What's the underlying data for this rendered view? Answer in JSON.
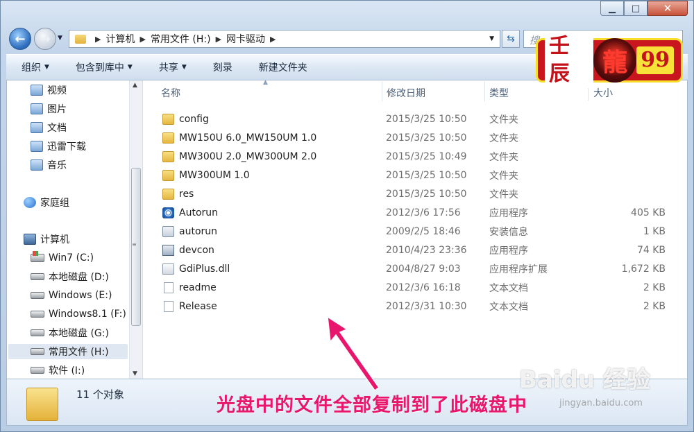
{
  "window": {
    "minimize_label": "▁",
    "maximize_label": "□",
    "close_label": "✕"
  },
  "address_bar": {
    "crumbs": [
      "计算机",
      "常用文件 (H:)",
      "网卡驱动"
    ]
  },
  "search": {
    "placeholder": "搜"
  },
  "toolbar": {
    "organize": "组织",
    "include_library": "包含到库中",
    "share": "共享",
    "burn": "刻录",
    "new_folder": "新建文件夹"
  },
  "sidebar": {
    "items": [
      {
        "label": "视频",
        "icon": "library-icon"
      },
      {
        "label": "图片",
        "icon": "library-icon"
      },
      {
        "label": "文档",
        "icon": "library-icon"
      },
      {
        "label": "迅雷下载",
        "icon": "library-icon"
      },
      {
        "label": "音乐",
        "icon": "library-icon"
      },
      {
        "label": "家庭组",
        "icon": "homegroup-icon"
      },
      {
        "label": "计算机",
        "icon": "computer-icon"
      },
      {
        "label": "Win7 (C:)",
        "icon": "system-drive-icon"
      },
      {
        "label": "本地磁盘 (D:)",
        "icon": "drive-icon"
      },
      {
        "label": "Windows (E:)",
        "icon": "drive-icon"
      },
      {
        "label": "Windows8.1 (F:)",
        "icon": "drive-icon"
      },
      {
        "label": "本地磁盘 (G:)",
        "icon": "drive-icon"
      },
      {
        "label": "常用文件 (H:)",
        "icon": "drive-icon",
        "selected": true
      },
      {
        "label": "软件 (I:)",
        "icon": "drive-icon"
      }
    ]
  },
  "columns": {
    "name": "名称",
    "date": "修改日期",
    "type": "类型",
    "size": "大小"
  },
  "files": [
    {
      "name": "config",
      "date": "2015/3/25 10:50",
      "type": "文件夹",
      "size": "",
      "icon": "folder-icon"
    },
    {
      "name": "MW150U 6.0_MW150UM 1.0",
      "date": "2015/3/25 10:50",
      "type": "文件夹",
      "size": "",
      "icon": "folder-icon"
    },
    {
      "name": "MW300U 2.0_MW300UM 2.0",
      "date": "2015/3/25 10:49",
      "type": "文件夹",
      "size": "",
      "icon": "folder-icon"
    },
    {
      "name": "MW300UM 1.0",
      "date": "2015/3/25 10:50",
      "type": "文件夹",
      "size": "",
      "icon": "folder-icon"
    },
    {
      "name": "res",
      "date": "2015/3/25 10:50",
      "type": "文件夹",
      "size": "",
      "icon": "folder-icon"
    },
    {
      "name": "Autorun",
      "date": "2012/3/6 17:56",
      "type": "应用程序",
      "size": "405 KB",
      "icon": "app-icon"
    },
    {
      "name": "autorun",
      "date": "2009/2/5 18:46",
      "type": "安装信息",
      "size": "1 KB",
      "icon": "setup-info-icon"
    },
    {
      "name": "devcon",
      "date": "2010/4/23 23:36",
      "type": "应用程序",
      "size": "74 KB",
      "icon": "exe-icon"
    },
    {
      "name": "GdiPlus.dll",
      "date": "2004/8/27 9:03",
      "type": "应用程序扩展",
      "size": "1,672 KB",
      "icon": "dll-icon"
    },
    {
      "name": "readme",
      "date": "2012/3/6 16:18",
      "type": "文本文档",
      "size": "2 KB",
      "icon": "text-file-icon"
    },
    {
      "name": "Release",
      "date": "2012/3/31 10:30",
      "type": "文本文档",
      "size": "2 KB",
      "icon": "text-file-icon"
    }
  ],
  "details": {
    "count": "11 个对象"
  },
  "overlay": {
    "caption": "光盘中的文件全部复制到了此磁盘中",
    "logo_left": "壬辰",
    "logo_center": "龍",
    "logo_right": "99",
    "watermark": "Baidu 经验",
    "watermark_sub": "jingyan.baidu.com"
  },
  "colors": {
    "caption": "#e8166d",
    "selection": "#dfe8f2",
    "logo_red": "#c9151d",
    "logo_yellow": "#f7dd2a"
  }
}
